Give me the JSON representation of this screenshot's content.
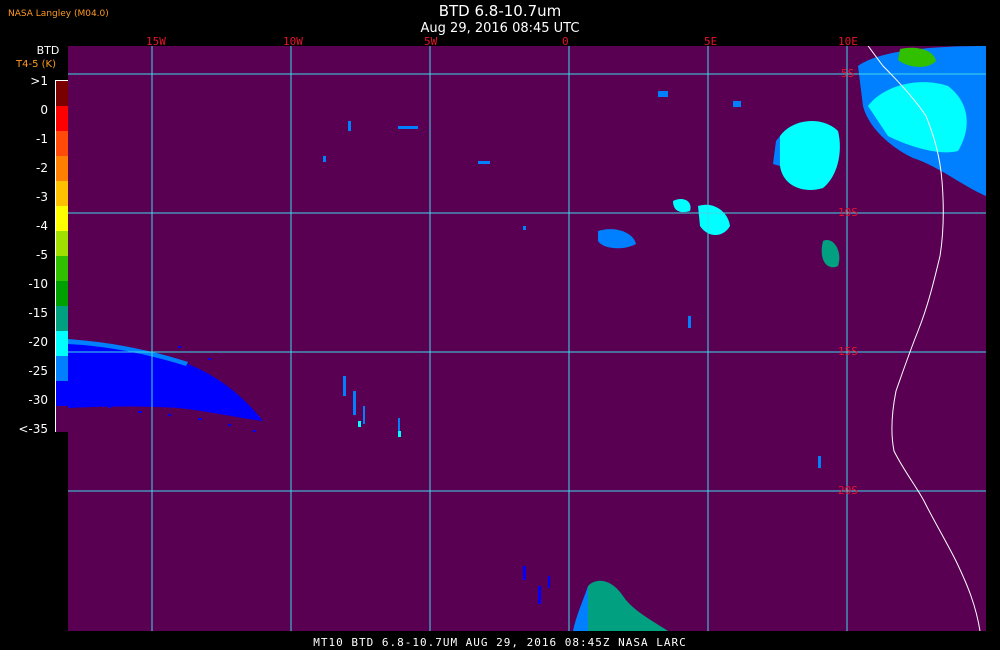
{
  "header": {
    "provider": "NASA Langley (M04.0)",
    "title": "BTD 6.8-10.7um",
    "subtitle": "Aug 29, 2016 08:45 UTC"
  },
  "legend": {
    "title": "BTD",
    "units": "T4-5 (K)",
    "labels": [
      ">1",
      "0",
      "-1",
      "-2",
      "-3",
      "-4",
      "-5",
      "-10",
      "-15",
      "-20",
      "-25",
      "-30",
      "<-35"
    ],
    "colors": [
      "#7a0000",
      "#ff0000",
      "#ff4a0a",
      "#ff8000",
      "#ffc000",
      "#ffff00",
      "#a0e000",
      "#30c000",
      "#00a000",
      "#00a080",
      "#00ffff",
      "#0080ff",
      "#0000ff",
      "#5a0052"
    ]
  },
  "grid": {
    "longitudes": [
      "15W",
      "10W",
      "5W",
      "0",
      "5E",
      "10E"
    ],
    "latitudes": [
      "5S",
      "10S",
      "15S",
      "20S"
    ],
    "line_color": "#3fd9e8",
    "label_color": "#e8132d"
  },
  "footer": {
    "text": "MT10   BTD 6.8-10.7UM    AUG 29, 2016 08:45Z    NASA LARC"
  },
  "map": {
    "background_color": "#5a0052",
    "coastline_color": "#ffffff"
  }
}
